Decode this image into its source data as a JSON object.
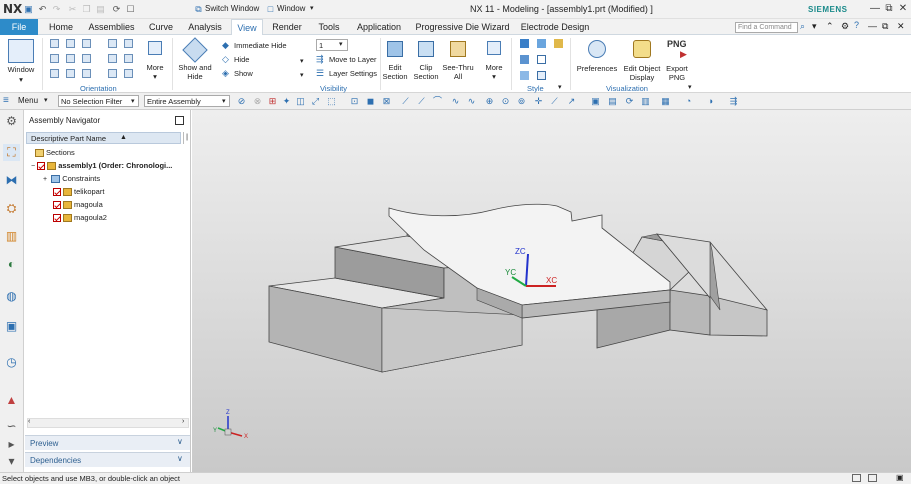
{
  "titlebar": {
    "logo": "NX",
    "title": "NX 11 - Modeling - [assembly1.prt (Modified) ]",
    "switch_window_label": "Switch Window",
    "window_menu_label": "Window",
    "brand": "SIEMENS"
  },
  "tabs": [
    "File",
    "Home",
    "Assemblies",
    "Curve",
    "Analysis",
    "View",
    "Render",
    "Tools",
    "Application",
    "Progressive Die Wizard",
    "Electrode Design"
  ],
  "find_command_placeholder": "Find a Command",
  "ribbon": {
    "window_label": "Window",
    "more_label": "More",
    "orientation_group": "Orientation",
    "show_hide_label": "Show and Hide",
    "immediate_hide_label": "Immediate Hide",
    "hide_label": "Hide",
    "show_label": "Show",
    "layer_value": "1",
    "move_to_layer_label": "Move to Layer",
    "layer_settings_label": "Layer Settings",
    "visibility_group": "Visibility",
    "edit_section_label": "Edit Section",
    "clip_section_label": "Clip Section",
    "see_thru_all_label": "See-Thru All",
    "more2_label": "More",
    "style_group": "Style",
    "preferences_label": "Preferences",
    "edit_object_display_label": "Edit Object Display",
    "export_png_label": "Export PNG",
    "png_text": "PNG",
    "visualization_group": "Visualization"
  },
  "selbar": {
    "menu_label": "Menu",
    "filter_value": "No Selection Filter",
    "scope_value": "Entire Assembly"
  },
  "navigator": {
    "title": "Assembly Navigator",
    "column_header": "Descriptive Part Name",
    "rows": [
      {
        "label": "Sections"
      },
      {
        "label": "assembly1 (Order: Chronologi..."
      },
      {
        "label": "Constraints"
      },
      {
        "label": "telikopart"
      },
      {
        "label": "magoula"
      },
      {
        "label": "magoula2"
      }
    ],
    "preview_label": "Preview",
    "dependencies_label": "Dependencies"
  },
  "viewport": {
    "triad_zc": "ZC",
    "triad_yc": "YC",
    "triad_xc": "XC",
    "small_z": "Z",
    "small_y": "Y",
    "small_x": "X"
  },
  "status": "Select objects and use MB3, or double-click an object",
  "colors": {
    "accent": "#2d8bc9",
    "viewport_top": "#eeeeee",
    "viewport_bottom": "#c9c9c9"
  }
}
